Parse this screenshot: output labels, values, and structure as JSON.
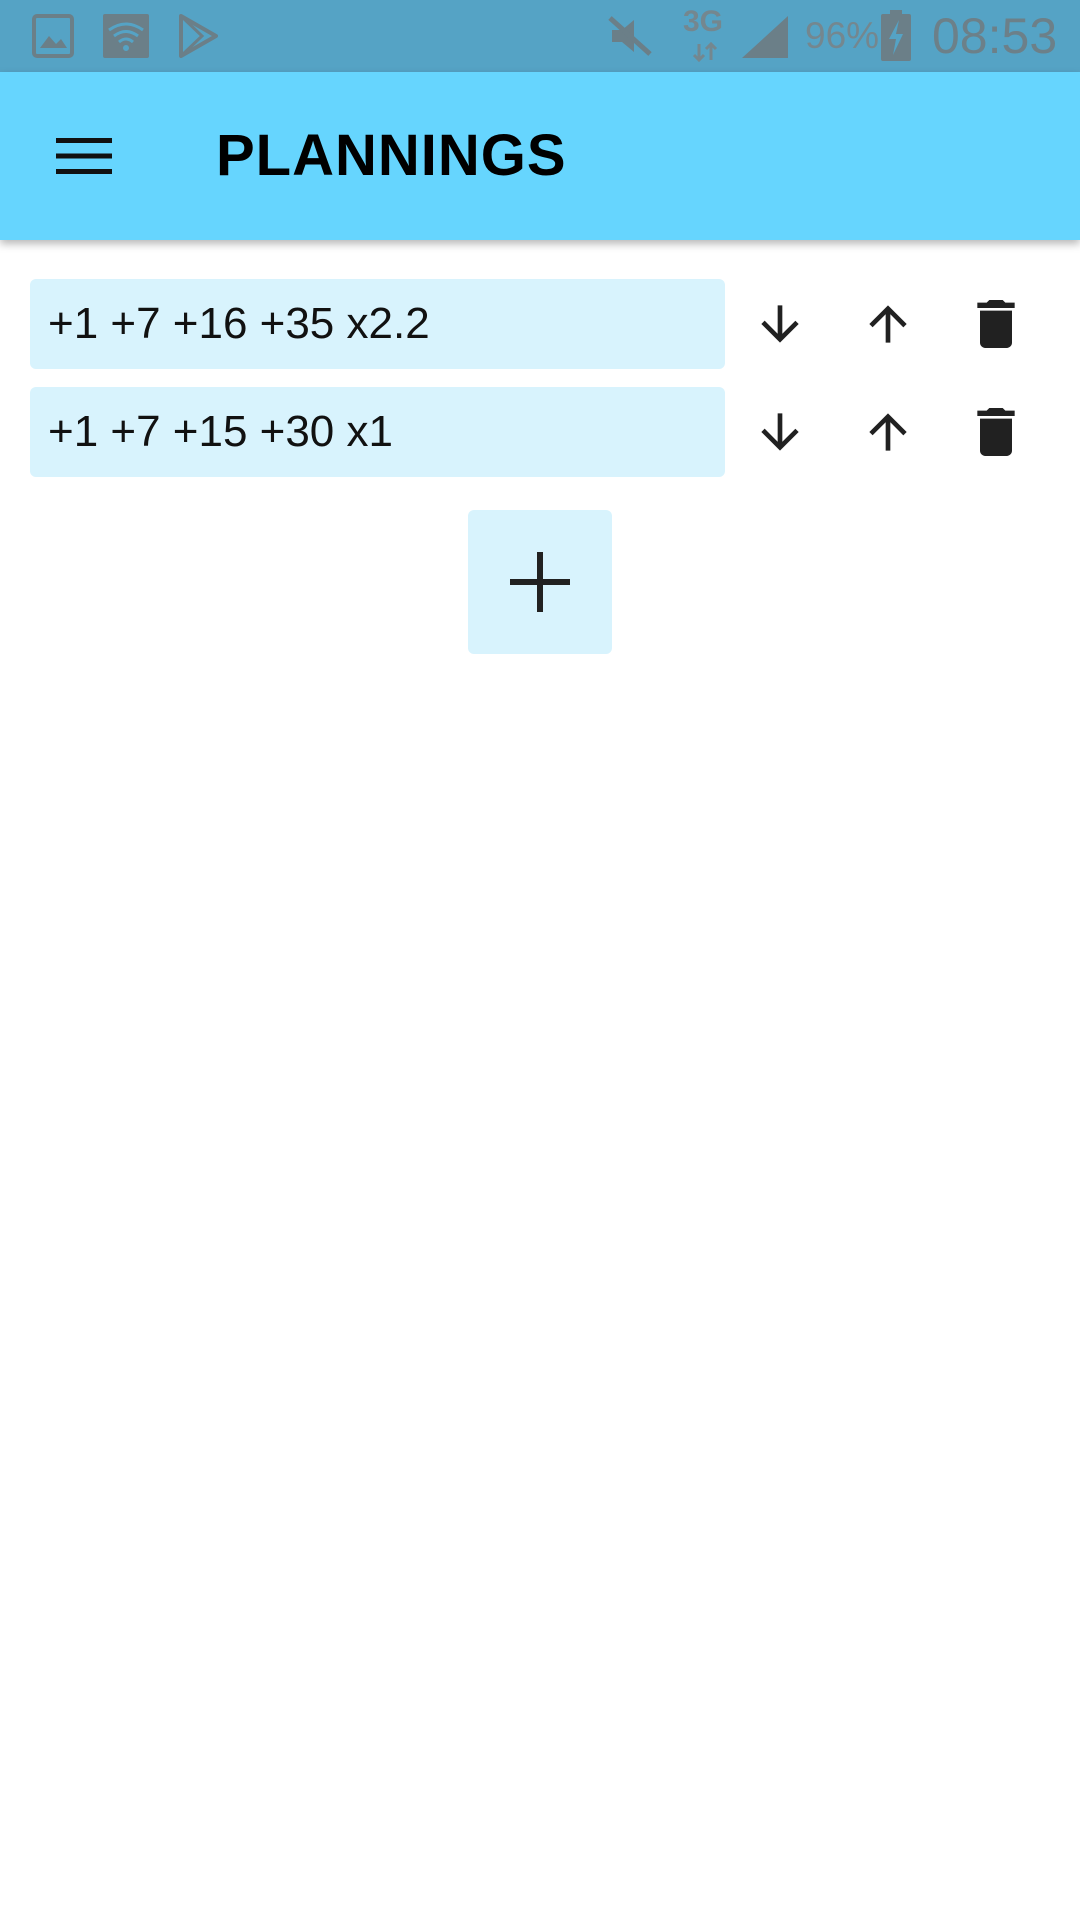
{
  "status_bar": {
    "network": "3G",
    "battery": "96%",
    "time": "08:53",
    "icons": [
      "gallery-icon",
      "wifi-icon",
      "play-store-icon",
      "mute-icon",
      "signal-icon",
      "battery-charging-icon"
    ]
  },
  "app_bar": {
    "title": "PLANNINGS",
    "menu_icon": "menu-icon"
  },
  "plannings": [
    {
      "value": "+1 +7 +16 +35 x2.2"
    },
    {
      "value": "+1 +7 +15 +30 x1"
    }
  ],
  "row_actions": [
    "move-down-icon",
    "move-up-icon",
    "delete-icon"
  ],
  "add_button": {
    "icon": "plus-icon"
  },
  "colors": {
    "status_bar": "#55a3c5",
    "app_bar": "#66d5fe",
    "field_bg": "#d8f3fd",
    "icon": "#212121"
  }
}
